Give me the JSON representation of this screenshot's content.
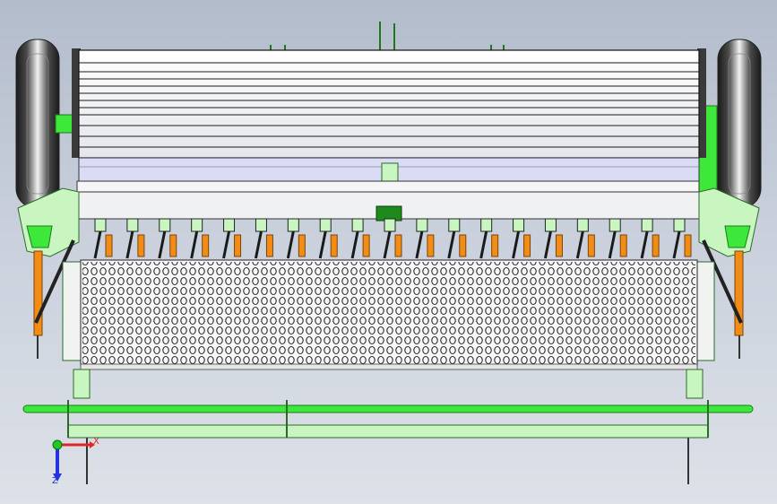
{
  "viewport": {
    "background_top": "#b3bccb",
    "background_bottom": "#dde1e8"
  },
  "model": {
    "frame_color": "#c8f5c0",
    "accent_color": "#3ee83a",
    "hopper_color": "#f2f3f4",
    "tube_color": "#f28c16",
    "tyre_color": "#2c2c2c",
    "drill_units": 19
  },
  "triad": {
    "x_label": "X",
    "y_label": "Y",
    "z_label": "Z",
    "x_color": "#e02424",
    "y_color": "#22c922",
    "z_color": "#2432e0"
  }
}
